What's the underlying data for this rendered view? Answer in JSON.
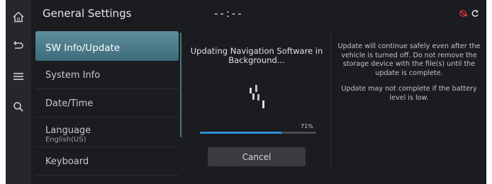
{
  "header": {
    "title": "General Settings",
    "clock": "--:--"
  },
  "rail": {
    "items": [
      {
        "icon": "home-icon"
      },
      {
        "icon": "back-icon"
      },
      {
        "icon": "menu-icon"
      },
      {
        "icon": "search-icon"
      }
    ]
  },
  "menu": {
    "items": [
      {
        "label": "SW Info/Update",
        "active": true
      },
      {
        "label": "System Info"
      },
      {
        "label": "Date/Time"
      },
      {
        "label": "Language",
        "sublabel": "English(US)"
      },
      {
        "label": "Keyboard"
      }
    ]
  },
  "update": {
    "title": "Updating Navigation Software in Background...",
    "progress_label": "71%",
    "progress_value": 0.71,
    "cancel_label": "Cancel"
  },
  "info": {
    "paragraph1": "Update will continue safely even after the vehicle is turned off. Do not remove the storage device with the file(s) until the update is complete.",
    "paragraph2": "Update may not complete if the battery level is low."
  },
  "colors": {
    "accent": "#2e90d8",
    "active_item": "#4e7d8c",
    "status_red": "#d9303a"
  }
}
